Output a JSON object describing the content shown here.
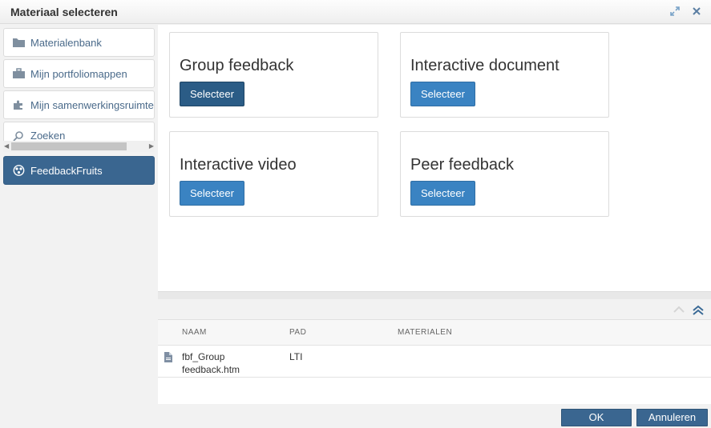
{
  "dialog": {
    "title": "Materiaal selecteren",
    "icons": [
      "expand-icon",
      "close-icon"
    ]
  },
  "sidebar": {
    "items": [
      {
        "label": "Materialenbank",
        "icon": "folder-icon"
      },
      {
        "label": "Mijn portfoliomappen",
        "icon": "briefcase-icon"
      },
      {
        "label": "Mijn samenwerkingsruimten",
        "icon": "puzzle-icon"
      },
      {
        "label": "Zoeken",
        "icon": "search-icon"
      },
      {
        "label": "FeedbackFruits",
        "icon": "feedbackfruits-icon",
        "active": true
      }
    ]
  },
  "cards": [
    {
      "title": "Group feedback",
      "button": "Selecteer",
      "selected": true
    },
    {
      "title": "Interactive document",
      "button": "Selecteer"
    },
    {
      "title": "Interactive video",
      "button": "Selecteer"
    },
    {
      "title": "Peer feedback",
      "button": "Selecteer"
    }
  ],
  "table": {
    "columns": [
      "NAAM",
      "PAD",
      "MATERIALEN"
    ],
    "rows": [
      {
        "name_line1": "fbf_Group",
        "name_line2": "feedback.htm",
        "path": "LTI",
        "materials": "",
        "icon": "file-icon"
      }
    ]
  },
  "footer": {
    "ok": "OK",
    "cancel": "Annuleren"
  },
  "colors": {
    "accent": "#3a83c2",
    "active_nav": "#3a6690",
    "selected_button": "#2b5c86"
  }
}
